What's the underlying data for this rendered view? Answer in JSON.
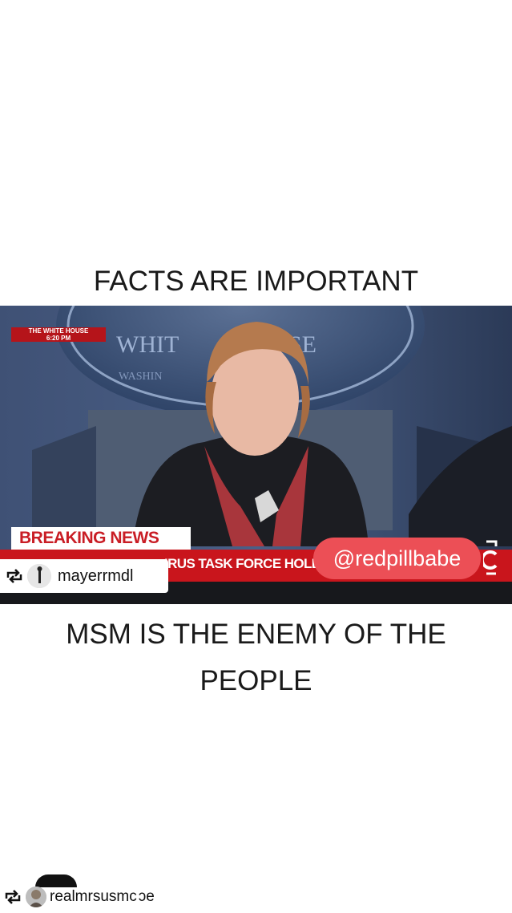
{
  "captions": {
    "top": "FACTS ARE IMPORTANT",
    "bottom_line1": "MSM IS THE ENEMY OF THE",
    "bottom_line2": "PEOPLE"
  },
  "video": {
    "station_line1": "THE WHITE HOUSE",
    "station_line2": "6:20 PM",
    "breaking": "BREAKING NEWS",
    "ticker": "IRUS TASK FORCE HOLD",
    "watermark": "@redpillbabe",
    "colors": {
      "news_red": "#c9151c",
      "pill": "#ec4f56"
    }
  },
  "repost": {
    "icon": "repost-icon",
    "username": "mayerrmdl"
  },
  "footer": {
    "icon": "repost-icon",
    "username": "realmrsusmc",
    "overflow": "ɔe"
  }
}
